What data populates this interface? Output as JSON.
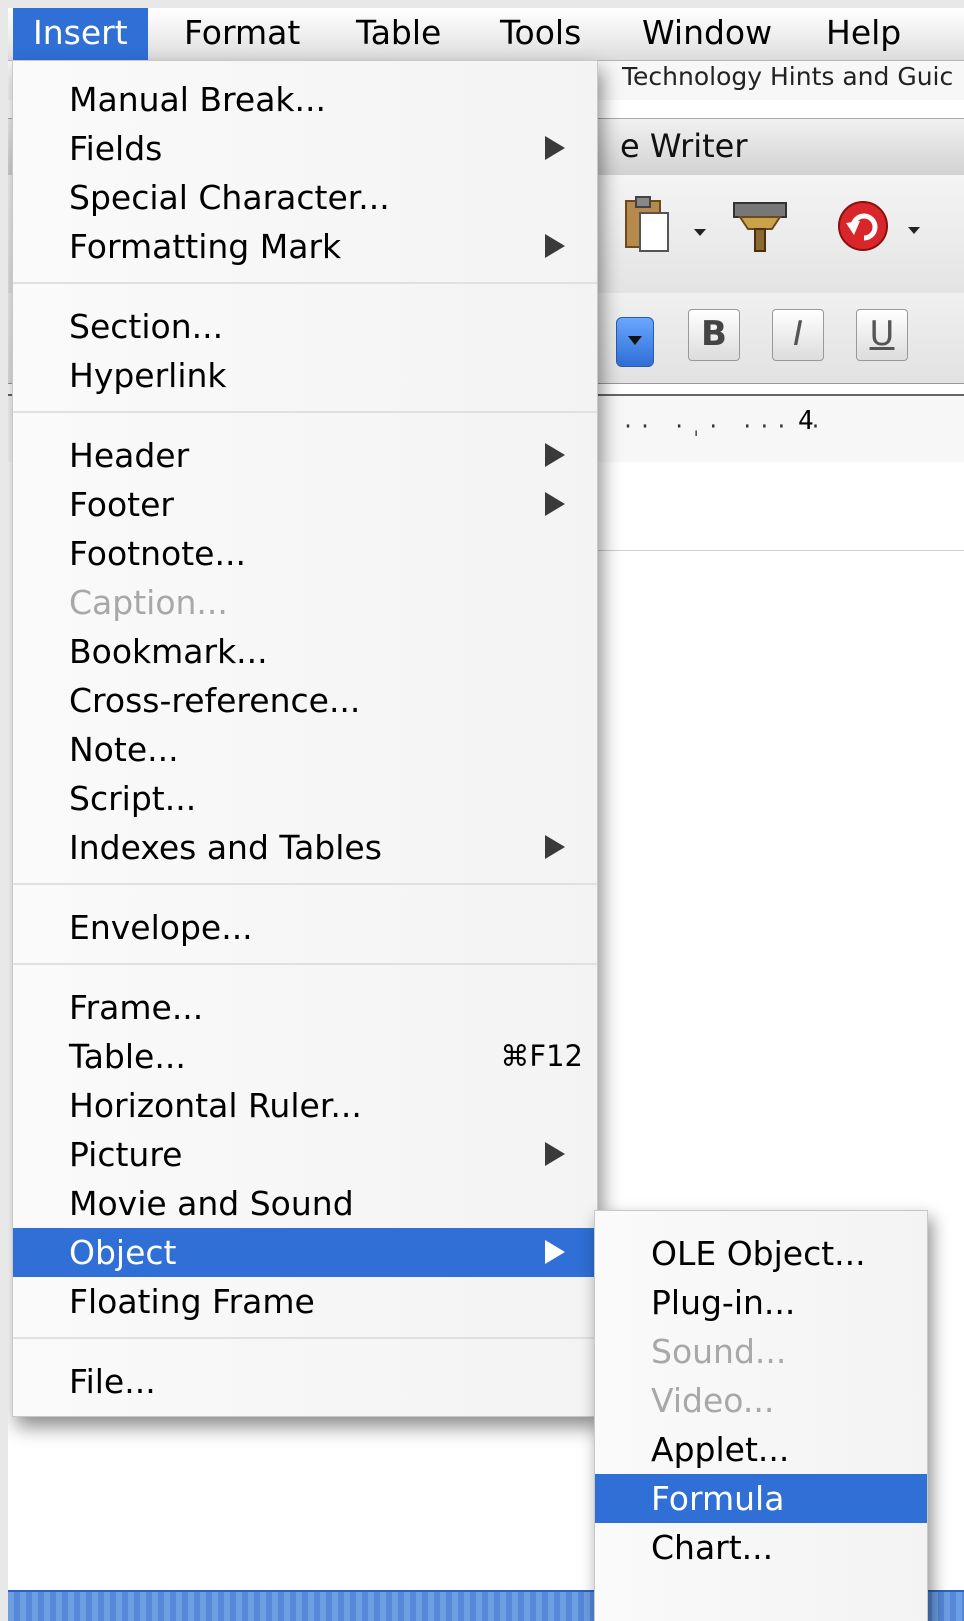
{
  "menubar": {
    "items": [
      {
        "label": "Insert",
        "active": true
      },
      {
        "label": "Format",
        "active": false
      },
      {
        "label": "Table",
        "active": false
      },
      {
        "label": "Tools",
        "active": false
      },
      {
        "label": "Window",
        "active": false
      },
      {
        "label": "Help",
        "active": false
      }
    ]
  },
  "background_window": {
    "site_title": "Technology Hints and Guic",
    "window_title": "e Writer",
    "ruler_number": "4",
    "format_buttons": {
      "bold": "B",
      "italic": "I",
      "underline": "U"
    }
  },
  "insert_menu": {
    "items": [
      {
        "label": "Manual Break...",
        "submenu": false,
        "disabled": false
      },
      {
        "label": "Fields",
        "submenu": true,
        "disabled": false
      },
      {
        "label": "Special Character...",
        "submenu": false,
        "disabled": false
      },
      {
        "label": "Formatting Mark",
        "submenu": true,
        "disabled": false
      },
      {
        "label": "Section...",
        "submenu": false,
        "disabled": false
      },
      {
        "label": "Hyperlink",
        "submenu": false,
        "disabled": false
      },
      {
        "label": "Header",
        "submenu": true,
        "disabled": false
      },
      {
        "label": "Footer",
        "submenu": true,
        "disabled": false
      },
      {
        "label": "Footnote...",
        "submenu": false,
        "disabled": false
      },
      {
        "label": "Caption...",
        "submenu": false,
        "disabled": true
      },
      {
        "label": "Bookmark...",
        "submenu": false,
        "disabled": false
      },
      {
        "label": "Cross-reference...",
        "submenu": false,
        "disabled": false
      },
      {
        "label": "Note...",
        "submenu": false,
        "disabled": false
      },
      {
        "label": "Script...",
        "submenu": false,
        "disabled": false
      },
      {
        "label": "Indexes and Tables",
        "submenu": true,
        "disabled": false
      },
      {
        "label": "Envelope...",
        "submenu": false,
        "disabled": false
      },
      {
        "label": "Frame...",
        "submenu": false,
        "disabled": false
      },
      {
        "label": "Table...",
        "submenu": false,
        "disabled": false,
        "shortcut": "⌘F12"
      },
      {
        "label": "Horizontal Ruler...",
        "submenu": false,
        "disabled": false
      },
      {
        "label": "Picture",
        "submenu": true,
        "disabled": false
      },
      {
        "label": "Movie and Sound",
        "submenu": false,
        "disabled": false
      },
      {
        "label": "Object",
        "submenu": true,
        "disabled": false,
        "highlighted": true
      },
      {
        "label": "Floating Frame",
        "submenu": false,
        "disabled": false
      },
      {
        "label": "File...",
        "submenu": false,
        "disabled": false
      }
    ]
  },
  "object_submenu": {
    "items": [
      {
        "label": "OLE Object...",
        "disabled": false
      },
      {
        "label": "Plug-in...",
        "disabled": false
      },
      {
        "label": "Sound...",
        "disabled": true
      },
      {
        "label": "Video...",
        "disabled": true
      },
      {
        "label": "Applet...",
        "disabled": false
      },
      {
        "label": "Formula",
        "disabled": false,
        "highlighted": true
      },
      {
        "label": "Chart...",
        "disabled": false
      }
    ]
  },
  "colors": {
    "highlight": "#2f6fd6",
    "disabled_text": "#a8a8a8",
    "undo_icon": "#d8262b"
  },
  "icons": [
    "paste-icon",
    "format-paintbrush-icon",
    "undo-icon",
    "dropdown-arrow-icon",
    "submenu-arrow-icon"
  ]
}
